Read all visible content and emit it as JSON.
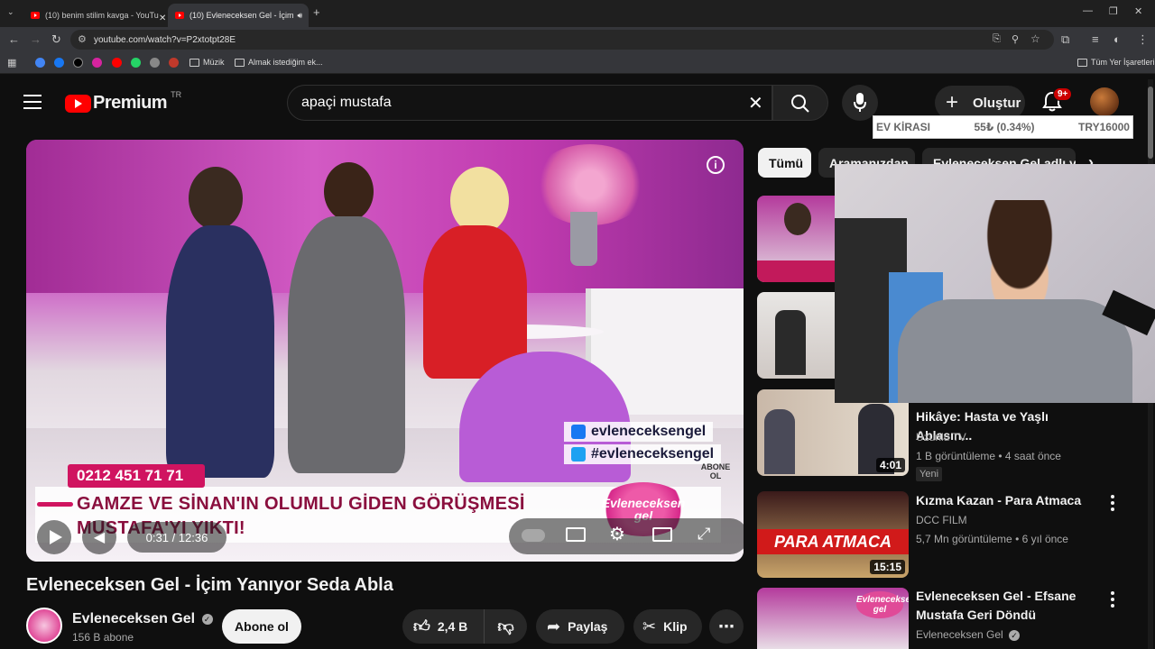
{
  "browser": {
    "tabs": [
      {
        "title": "(10) benim stilim kavga - YouTu",
        "active": false
      },
      {
        "title": "(10) Evleneceksen Gel - İçim",
        "active": true
      }
    ],
    "url": "youtube.com/watch?v=P2xtotpt28E",
    "bookmarks": [
      {
        "label": "Müzik",
        "type": "folder"
      },
      {
        "label": "Almak istediğim ek...",
        "type": "folder"
      }
    ],
    "all_bookmarks_label": "Tüm Yer İşaretleri"
  },
  "masthead": {
    "logo_text": "Premium",
    "region": "TR",
    "search_value": "apaçi mustafa",
    "create_label": "Oluştur",
    "notification_count": "9+"
  },
  "ticker": {
    "name": "EV KİRASI",
    "change": "55₺ (0.34%)",
    "value": "TRY16000"
  },
  "video": {
    "phone": "0212 451 71 71",
    "banner_line1": "GAMZE VE SİNAN'IN OLUMLU GİDEN GÖRÜŞMESİ",
    "banner_line2": "MUSTAFA'YI YIKTI!",
    "social_facebook": "evleneceksengel",
    "social_twitter": "#evleneceksengel",
    "subscribe_watermark": "ABONE OL",
    "show_logo": "Evleneceksen gel",
    "time_current": "0:31",
    "time_total": "12:36",
    "time_display": "0:31 / 12:36"
  },
  "watch": {
    "title": "Evleneceksen Gel - İçim Yanıyor Seda Abla",
    "channel": "Evleneceksen Gel",
    "subscribers": "156 B abone",
    "subscribe_label": "Abone ol",
    "likes": "2,4 B",
    "share_label": "Paylaş",
    "clip_label": "Klip"
  },
  "sidebar": {
    "chips": [
      "Tümü",
      "Aramanızdan",
      "Evleneceksen Gel adlı yü"
    ],
    "videos": [
      {
        "title": "",
        "channel": "",
        "meta": "",
        "duration": ""
      },
      {
        "title": "",
        "channel": "",
        "meta": "",
        "duration": ""
      },
      {
        "title": "Hikâye: Hasta ve Yaşlı Ablasın...",
        "channel": "Uzunlu TV",
        "meta": "1 B görüntüleme • 4 saat önce",
        "duration": "4:01",
        "badge": "Yeni"
      },
      {
        "title": "Kızma Kazan - Para Atmaca",
        "channel": "DCC FILM",
        "meta": "5,7 Mn görüntüleme • 6 yıl önce",
        "duration": "15:15",
        "thumb_text": "PARA ATMACA"
      },
      {
        "title": "Evleneceksen Gel - Efsane Mustafa Geri Döndü",
        "channel": "Evleneceksen Gel",
        "meta": "",
        "duration": "",
        "thumb_text": "Evleneceksen gel"
      }
    ]
  },
  "colors": {
    "accent": "#ff0000",
    "background": "#0f0f0f",
    "banner_pink": "#d01460"
  }
}
